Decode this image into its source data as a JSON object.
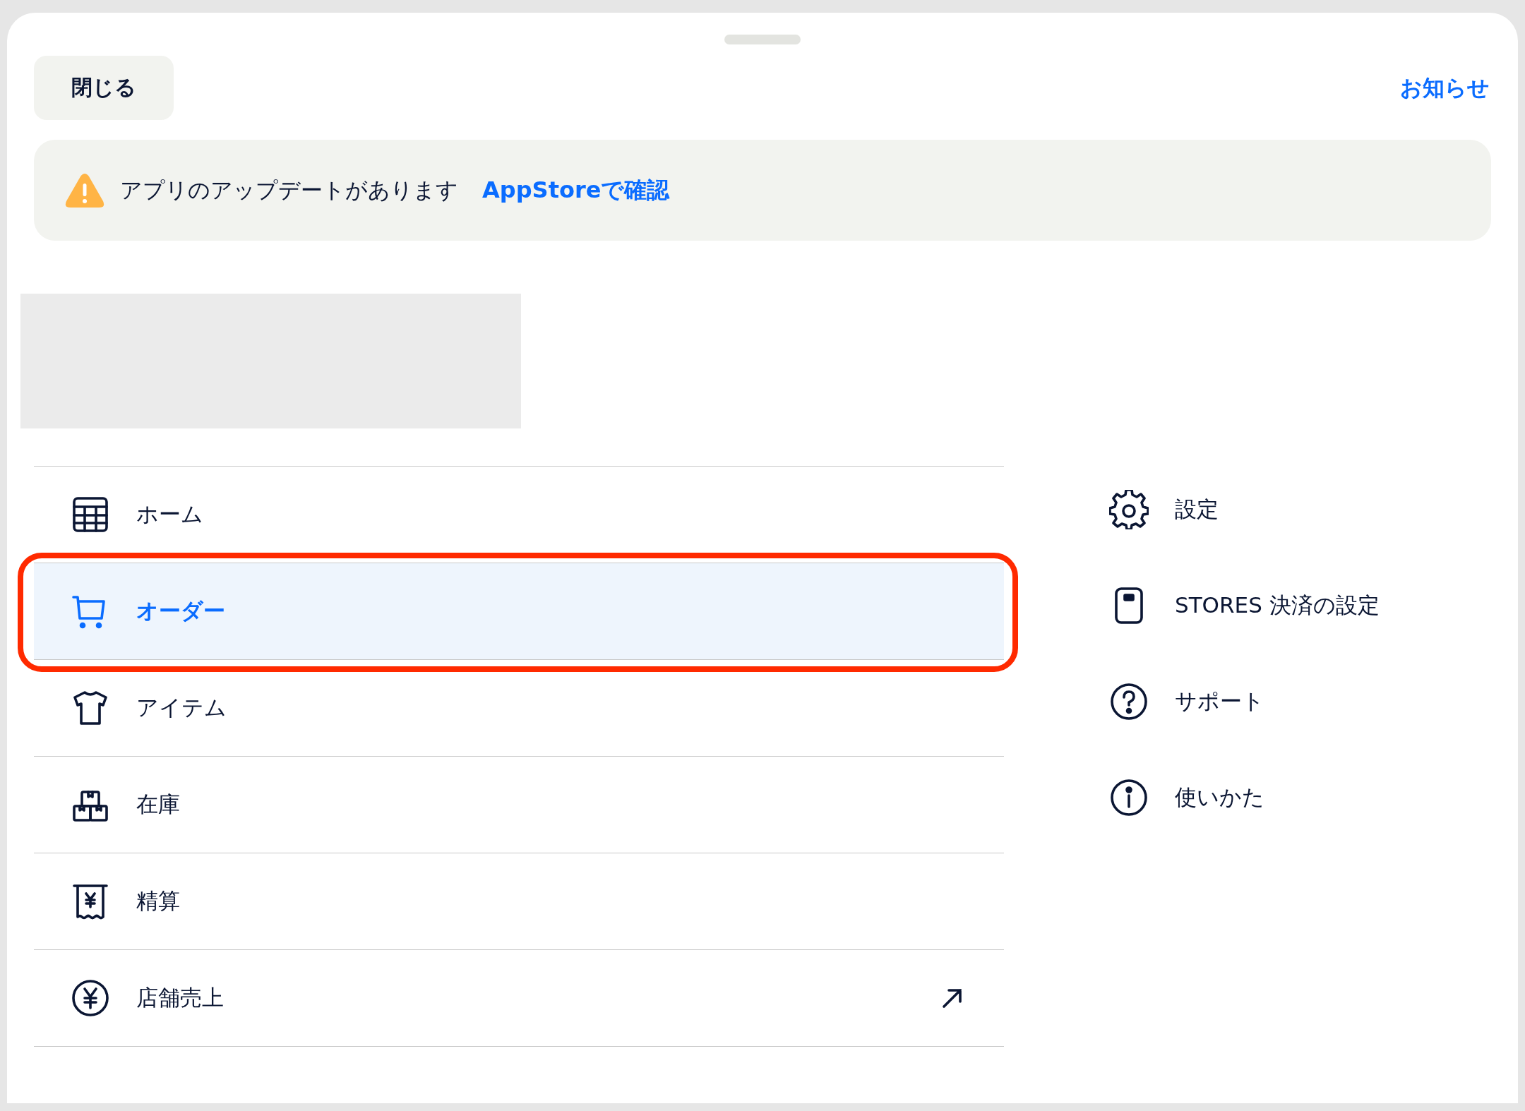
{
  "header": {
    "close_button": "閉じる",
    "notices_link": "お知らせ"
  },
  "update_banner": {
    "message": "アプリのアップデートがあります",
    "link": "AppStoreで確認"
  },
  "main_menu": [
    {
      "kind": "grid",
      "label": "ホーム",
      "selected": false,
      "external": false,
      "highlighted": false
    },
    {
      "kind": "cart",
      "label": "オーダー",
      "selected": true,
      "external": false,
      "highlighted": true
    },
    {
      "kind": "shirt",
      "label": "アイテム",
      "selected": false,
      "external": false,
      "highlighted": false
    },
    {
      "kind": "boxes",
      "label": "在庫",
      "selected": false,
      "external": false,
      "highlighted": false
    },
    {
      "kind": "receipt",
      "label": "精算",
      "selected": false,
      "external": false,
      "highlighted": false
    },
    {
      "kind": "yen",
      "label": "店舗売上",
      "selected": false,
      "external": true,
      "highlighted": false
    }
  ],
  "side_menu": [
    {
      "kind": "gear",
      "label": "設定"
    },
    {
      "kind": "terminal",
      "label": "STORES 決済の設定"
    },
    {
      "kind": "help",
      "label": "サポート"
    },
    {
      "kind": "info",
      "label": "使いかた"
    }
  ]
}
